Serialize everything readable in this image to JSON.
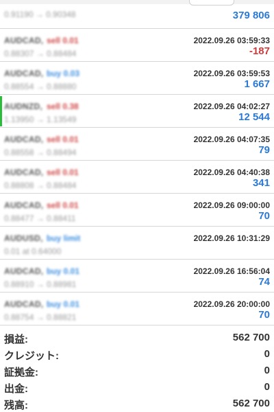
{
  "rows": [
    {
      "symbol": "",
      "side": "",
      "prices": "0.91190 → 0.90348",
      "time": "",
      "profit": "379 806",
      "profit_sign": "pos"
    },
    {
      "symbol": "AUDCAD,",
      "side": "sell 0.01",
      "prices": "0.88307 → 0.88484",
      "time": "2022.09.26 03:59:33",
      "profit": "-187",
      "profit_sign": "neg"
    },
    {
      "symbol": "AUDCAD,",
      "side": "buy 0.03",
      "prices": "0.88554 → 0.88880",
      "time": "2022.09.26 03:59:53",
      "profit": "1 667",
      "profit_sign": "pos"
    },
    {
      "symbol": "AUDNZD,",
      "side": "sell 0.38",
      "prices": "1.13950 → 1.13549",
      "time": "2022.09.26 04:02:27",
      "profit": "12 544",
      "profit_sign": "pos"
    },
    {
      "symbol": "AUDCAD,",
      "side": "sell 0.01",
      "prices": "0.88558 → 0.88494",
      "time": "2022.09.26 04:07:35",
      "profit": "79",
      "profit_sign": "pos"
    },
    {
      "symbol": "AUDCAD,",
      "side": "sell 0.01",
      "prices": "0.88808 → 0.88484",
      "time": "2022.09.26 04:40:38",
      "profit": "341",
      "profit_sign": "pos"
    },
    {
      "symbol": "AUDCAD,",
      "side": "sell 0.01",
      "prices": "0.88477 → 0.88411",
      "time": "2022.09.26 09:00:00",
      "profit": "70",
      "profit_sign": "pos"
    },
    {
      "symbol": "AUDUSD,",
      "side": "buy limit",
      "prices": "0.01 at 0.64000",
      "time": "2022.09.26 10:31:29",
      "profit": "",
      "profit_sign": "pos"
    },
    {
      "symbol": "AUDCAD,",
      "side": "buy 0.01",
      "prices": "0.88910 → 0.88981",
      "time": "2022.09.26 16:56:04",
      "profit": "74",
      "profit_sign": "pos"
    },
    {
      "symbol": "AUDCAD,",
      "side": "buy 0.01",
      "prices": "0.88754 → 0.88821",
      "time": "2022.09.26 20:00:00",
      "profit": "70",
      "profit_sign": "pos"
    }
  ],
  "summary": [
    {
      "label": "損益:",
      "value": "562 700"
    },
    {
      "label": "クレジット:",
      "value": "0"
    },
    {
      "label": "証拠金:",
      "value": "0"
    },
    {
      "label": "出金:",
      "value": "0"
    },
    {
      "label": "残高:",
      "value": "562 700"
    }
  ],
  "colors": {
    "positive": "#2a79d8",
    "negative": "#d13b3b",
    "sell": "#d04545",
    "buy": "#3a8ee0",
    "accent": "#2bbd3a"
  }
}
